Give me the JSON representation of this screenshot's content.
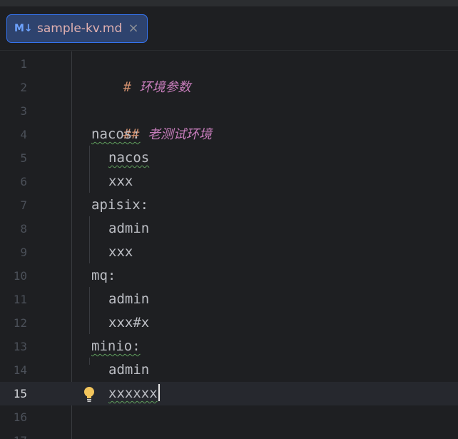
{
  "tab": {
    "icon_label": "M↓",
    "filename": "sample-kv.md",
    "close_glyph": "×"
  },
  "editor": {
    "current_line": 15,
    "lines": [
      {
        "num": "1",
        "text": "环境参数",
        "hash": "#"
      },
      {
        "num": "2",
        "text": ""
      },
      {
        "num": "3",
        "text": "老测试环境",
        "hash": "##"
      },
      {
        "num": "4",
        "text": "nacos:"
      },
      {
        "num": "5",
        "text": "nacos"
      },
      {
        "num": "6",
        "text": "xxx"
      },
      {
        "num": "7",
        "text": "apisix:"
      },
      {
        "num": "8",
        "text": "admin"
      },
      {
        "num": "9",
        "text": "xxx"
      },
      {
        "num": "10",
        "text": "mq:"
      },
      {
        "num": "11",
        "text": "admin"
      },
      {
        "num": "12",
        "text": "xxx#x"
      },
      {
        "num": "13",
        "text": "minio:"
      },
      {
        "num": "14",
        "text": "admin"
      },
      {
        "num": "15",
        "text": "xxxxxx"
      },
      {
        "num": "16",
        "text": ""
      },
      {
        "num": "17",
        "text": ""
      }
    ]
  },
  "colors": {
    "accent": "#3574f0",
    "heading": "#c77dbb",
    "hash_marker": "#cf8e6d",
    "typo_underline": "#5f9e5c",
    "bulb": "#f2c55c"
  },
  "icons": {
    "tab_icon": "markdown-icon",
    "close": "close-icon",
    "intention": "lightbulb-icon"
  }
}
